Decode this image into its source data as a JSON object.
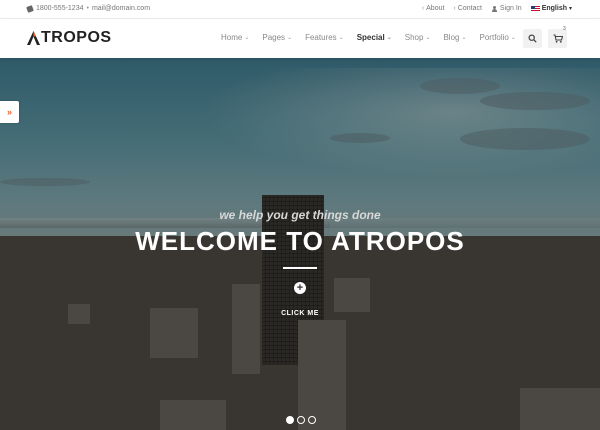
{
  "topbar": {
    "phone": "1800-555-1234",
    "separator": "•",
    "email": "mail@domain.com",
    "links": {
      "about": "About",
      "contact": "Contact",
      "signin": "Sign In",
      "language": "English"
    }
  },
  "header": {
    "logo": "TROPOS",
    "nav": [
      {
        "label": "Home"
      },
      {
        "label": "Pages"
      },
      {
        "label": "Features"
      },
      {
        "label": "Special"
      },
      {
        "label": "Shop"
      },
      {
        "label": "Blog"
      },
      {
        "label": "Portfolio"
      }
    ],
    "cart_count": "3"
  },
  "hero": {
    "tagline": "we help you get things done",
    "headline": "WELCOME TO ATROPOS",
    "cta_label": "CLICK ME",
    "slides_total": 3,
    "active_slide": 1
  },
  "side_tab": {
    "glyph": "»"
  },
  "colors": {
    "accent": "#e8632a",
    "header_bg": "#ffffff",
    "text_dark": "#222222",
    "nav_muted": "#888888"
  },
  "icons": [
    "phone-icon",
    "chevron-left-icon",
    "person-icon",
    "flag-icon",
    "search-icon",
    "cart-icon",
    "plus-icon",
    "double-chevron-right-icon"
  ]
}
